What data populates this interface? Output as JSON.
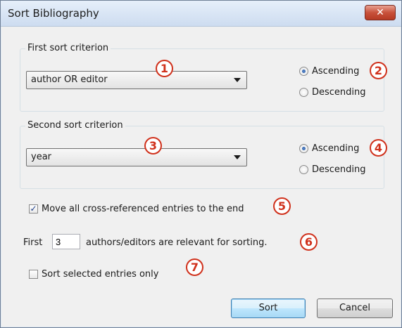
{
  "window": {
    "title": "Sort Bibliography",
    "close_symbol": "✕"
  },
  "first_group": {
    "label": "First sort criterion",
    "dropdown_value": "author OR editor",
    "ascending": "Ascending",
    "descending": "Descending",
    "selected": "ascending"
  },
  "second_group": {
    "label": "Second sort criterion",
    "dropdown_value": "year",
    "ascending": "Ascending",
    "descending": "Descending",
    "selected": "ascending"
  },
  "options": {
    "move_cross_ref_prefix": "",
    "move_cross_ref_label": "Move all cross-referenced entries to the end",
    "move_cross_ref_checked": true,
    "first_prefix": "First",
    "authors_count": "3",
    "first_suffix": "authors/editors are relevant for sorting.",
    "sort_selected_label": "Sort selected entries only",
    "sort_selected_checked": false
  },
  "buttons": {
    "sort": "Sort",
    "cancel": "Cancel"
  },
  "markers": [
    "1",
    "2",
    "3",
    "4",
    "5",
    "6",
    "7"
  ],
  "colors": {
    "marker": "#d0311c",
    "accent": "#3c7fb1"
  }
}
